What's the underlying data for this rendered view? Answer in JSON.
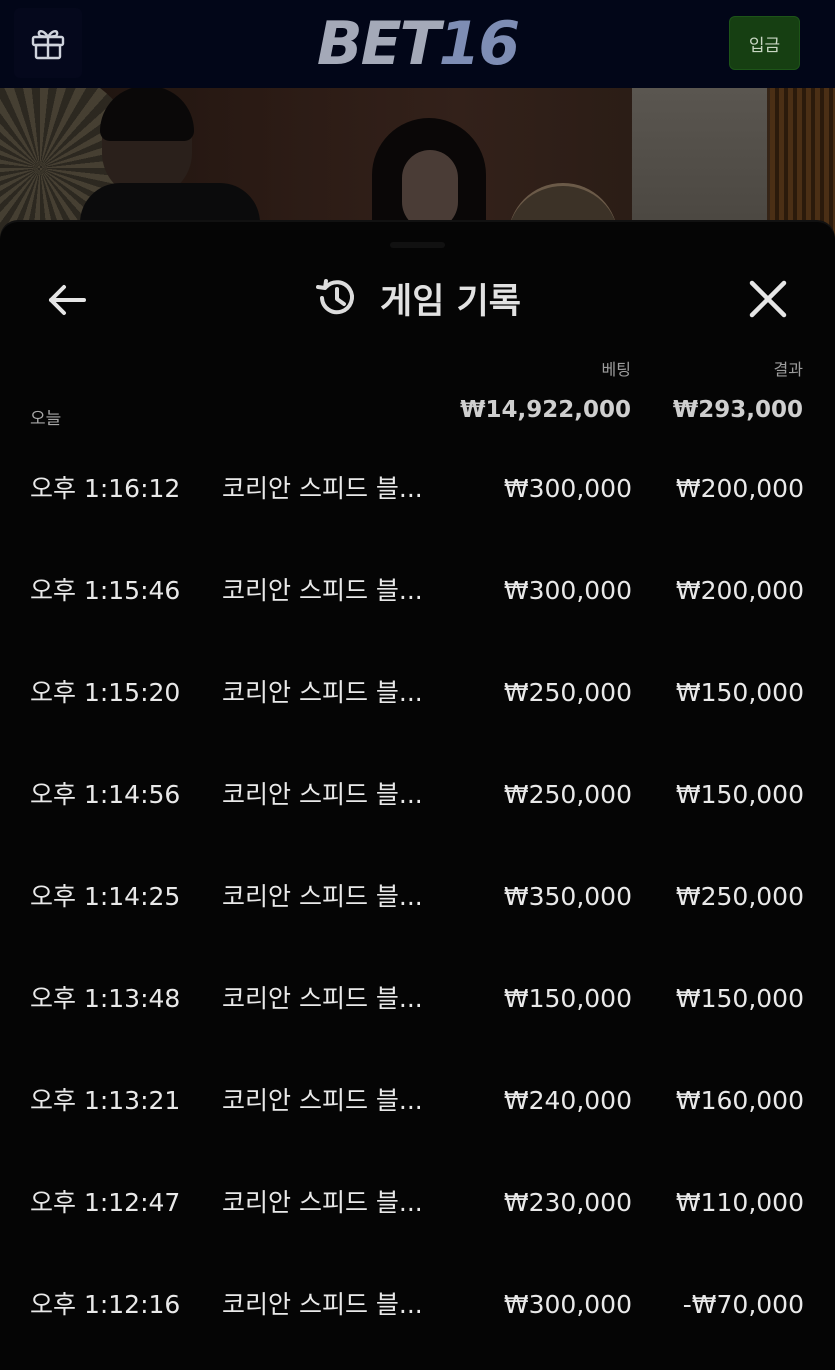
{
  "header": {
    "logo_prefix": "BET",
    "logo_number": "16",
    "deposit_label": "입금",
    "gift_icon": "gift-icon"
  },
  "panel": {
    "title": "게임 기록",
    "title_icon": "history-icon",
    "back_icon": "arrow-left-icon",
    "close_icon": "close-icon",
    "columns": {
      "bet": "베팅",
      "result": "결과"
    },
    "group_label": "오늘",
    "total_bet": "₩14,922,000",
    "total_result": "₩293,000",
    "rows": [
      {
        "time": "오후 1:16:12",
        "game": "코리안 스피드 블...",
        "bet": "₩300,000",
        "result": "₩200,000"
      },
      {
        "time": "오후 1:15:46",
        "game": "코리안 스피드 블...",
        "bet": "₩300,000",
        "result": "₩200,000"
      },
      {
        "time": "오후 1:15:20",
        "game": "코리안 스피드 블...",
        "bet": "₩250,000",
        "result": "₩150,000"
      },
      {
        "time": "오후 1:14:56",
        "game": "코리안 스피드 블...",
        "bet": "₩250,000",
        "result": "₩150,000"
      },
      {
        "time": "오후 1:14:25",
        "game": "코리안 스피드 블...",
        "bet": "₩350,000",
        "result": "₩250,000"
      },
      {
        "time": "오후 1:13:48",
        "game": "코리안 스피드 블...",
        "bet": "₩150,000",
        "result": "₩150,000"
      },
      {
        "time": "오후 1:13:21",
        "game": "코리안 스피드 블...",
        "bet": "₩240,000",
        "result": "₩160,000"
      },
      {
        "time": "오후 1:12:47",
        "game": "코리안 스피드 블...",
        "bet": "₩230,000",
        "result": "₩110,000"
      },
      {
        "time": "오후 1:12:16",
        "game": "코리안 스피드 블...",
        "bet": "₩300,000",
        "result": "-₩70,000"
      }
    ]
  },
  "colors": {
    "topbar": "#020618",
    "deposit_button": "#163f12",
    "panel_bg": "#050505",
    "text_primary": "#e9e9e9",
    "text_muted": "#9d9d9d"
  }
}
